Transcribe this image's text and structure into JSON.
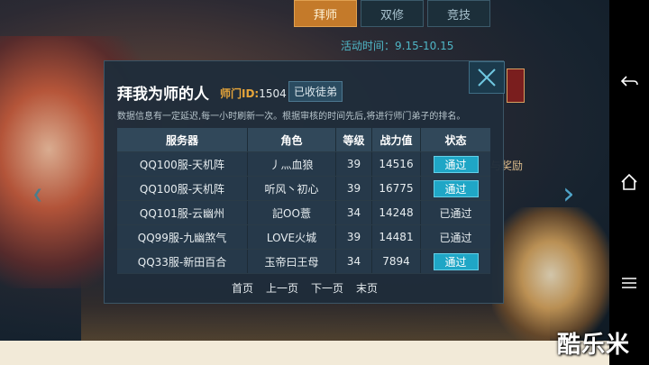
{
  "top_tabs": [
    {
      "label": "拜师",
      "active": true
    },
    {
      "label": "双修",
      "active": false
    },
    {
      "label": "竞技",
      "active": false
    }
  ],
  "activity_time": "活动时间：9.15-10.15",
  "side_text": "与奖励",
  "dialog": {
    "title": "拜我为师的人",
    "master_id_label": "师门ID:",
    "master_id_value": "1504",
    "accepted_button": "已收徒弟",
    "notice": "数据信息有一定延迟,每一小时刷新一次。根据审核的时间先后,将进行师门弟子的排名。",
    "columns": [
      "服务器",
      "角色",
      "等级",
      "战力值",
      "状态"
    ],
    "rows": [
      {
        "server": "QQ100服-天机阵",
        "role": "丿灬血狼",
        "level": "39",
        "power": "14516",
        "status": "通过",
        "is_button": true
      },
      {
        "server": "QQ100服-天机阵",
        "role": "听风丶初心",
        "level": "39",
        "power": "16775",
        "status": "通过",
        "is_button": true
      },
      {
        "server": "QQ101服-云幽州",
        "role": "記OO薏",
        "level": "34",
        "power": "14248",
        "status": "已通过",
        "is_button": false
      },
      {
        "server": "QQ99服-九幽煞气",
        "role": "LOVE火城",
        "level": "39",
        "power": "14481",
        "status": "已通过",
        "is_button": false
      },
      {
        "server": "QQ33服-新田百合",
        "role": "玉帝曰王母",
        "level": "34",
        "power": "7894",
        "status": "通过",
        "is_button": true
      }
    ],
    "pager": {
      "first": "首页",
      "prev": "上一页",
      "next": "下一页",
      "last": "末页"
    }
  },
  "watermark": "酷乐米",
  "colors": {
    "accent": "#1fa6c6",
    "id_label": "#e6a53a",
    "dialog_bg": "#1f2d3a"
  }
}
